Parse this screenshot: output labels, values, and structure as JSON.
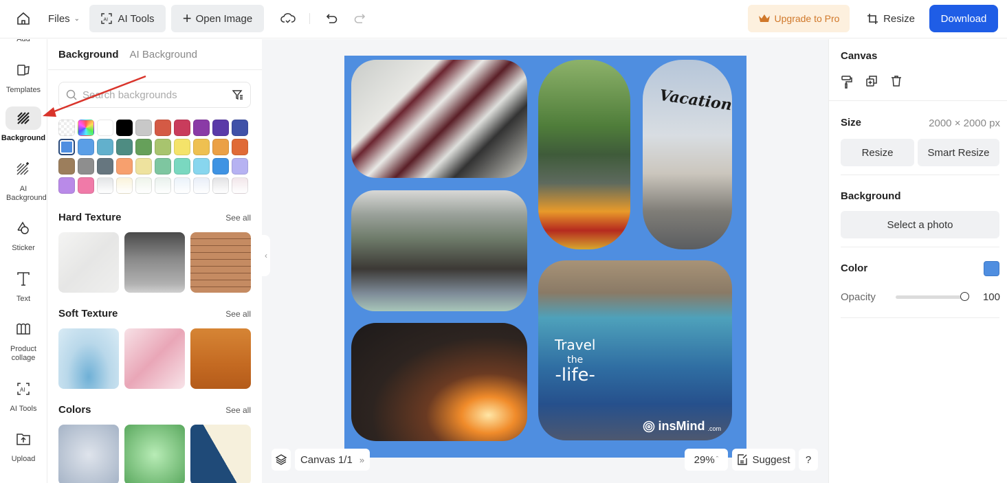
{
  "topbar": {
    "files_label": "Files",
    "ai_tools_label": "AI Tools",
    "open_image_label": "Open Image",
    "upgrade_label": "Upgrade to Pro",
    "resize_label": "Resize",
    "download_label": "Download"
  },
  "rail": {
    "partial_label": "Add",
    "items": [
      {
        "label": "Templates",
        "icon": "templates-icon"
      },
      {
        "label": "Background",
        "icon": "background-hatch-icon",
        "active": true
      },
      {
        "label": "AI Background",
        "icon": "ai-background-icon"
      },
      {
        "label": "Sticker",
        "icon": "sticker-icon"
      },
      {
        "label": "Text",
        "icon": "text-icon"
      },
      {
        "label": "Product collage",
        "icon": "collage-icon"
      },
      {
        "label": "AI Tools",
        "icon": "ai-tools-icon"
      },
      {
        "label": "Upload",
        "icon": "upload-icon"
      }
    ]
  },
  "panel": {
    "tabs": [
      {
        "label": "Background",
        "active": true
      },
      {
        "label": "AI Background",
        "active": false
      }
    ],
    "search_placeholder": "Search backgrounds",
    "swatches": [
      "transparent",
      "rainbow",
      "#ffffff",
      "#000000",
      "#c8c8c8",
      "#d45a45",
      "#c93c5c",
      "#8a3aa6",
      "#5a3aa8",
      "#3f51a8",
      "#4f8ee0",
      "#5a9ee6",
      "#62b0cc",
      "#4e8c82",
      "#66a05a",
      "#a8c46e",
      "#f4e36a",
      "#eec051",
      "#eba046",
      "#e06a37",
      "#9c7e5c",
      "#8e8e8e",
      "#66767f",
      "#f7a06e",
      "#eee29e",
      "#7ec6a0",
      "#7ad8c0",
      "#88d6ee",
      "#3f93e3",
      "#b6b2f2",
      "#b98ae8",
      "#f07aa8",
      "#e2e4e6",
      "#faf3da",
      "#eef4ea",
      "#e8f1ec",
      "#eaf2fa",
      "#e8eef8",
      "#e2e2e4",
      "#f2e6ea"
    ],
    "selected_swatch_index": 10,
    "sections": [
      {
        "title": "Hard Texture",
        "see_all": "See all",
        "items": [
          "white-marble",
          "gray-concrete",
          "wood-planks"
        ]
      },
      {
        "title": "Soft Texture",
        "see_all": "See all",
        "items": [
          "water-splash",
          "pink-silk",
          "orange-gradient"
        ]
      },
      {
        "title": "Colors",
        "see_all": "See all",
        "items": [
          "blue-gray-vignette",
          "green-vignette",
          "navy-cream-diagonal"
        ]
      }
    ]
  },
  "canvas": {
    "background_color": "#4f8ee0",
    "vacation_text": "Vacation",
    "travel_line1": "Travel",
    "travel_line2": "the",
    "travel_line3": "-life-",
    "watermark": "insMind",
    "watermark_suffix": ".com",
    "page_label": "Canvas 1/1",
    "zoom_label": "29%",
    "suggest_label": "Suggest",
    "help_label": "?"
  },
  "right_panel": {
    "canvas_title": "Canvas",
    "size_title": "Size",
    "size_value": "2000 × 2000 px",
    "resize_label": "Resize",
    "smart_resize_label": "Smart Resize",
    "background_title": "Background",
    "select_photo_label": "Select a photo",
    "color_title": "Color",
    "color_value": "#4f8ee0",
    "opacity_label": "Opacity",
    "opacity_value": "100"
  }
}
